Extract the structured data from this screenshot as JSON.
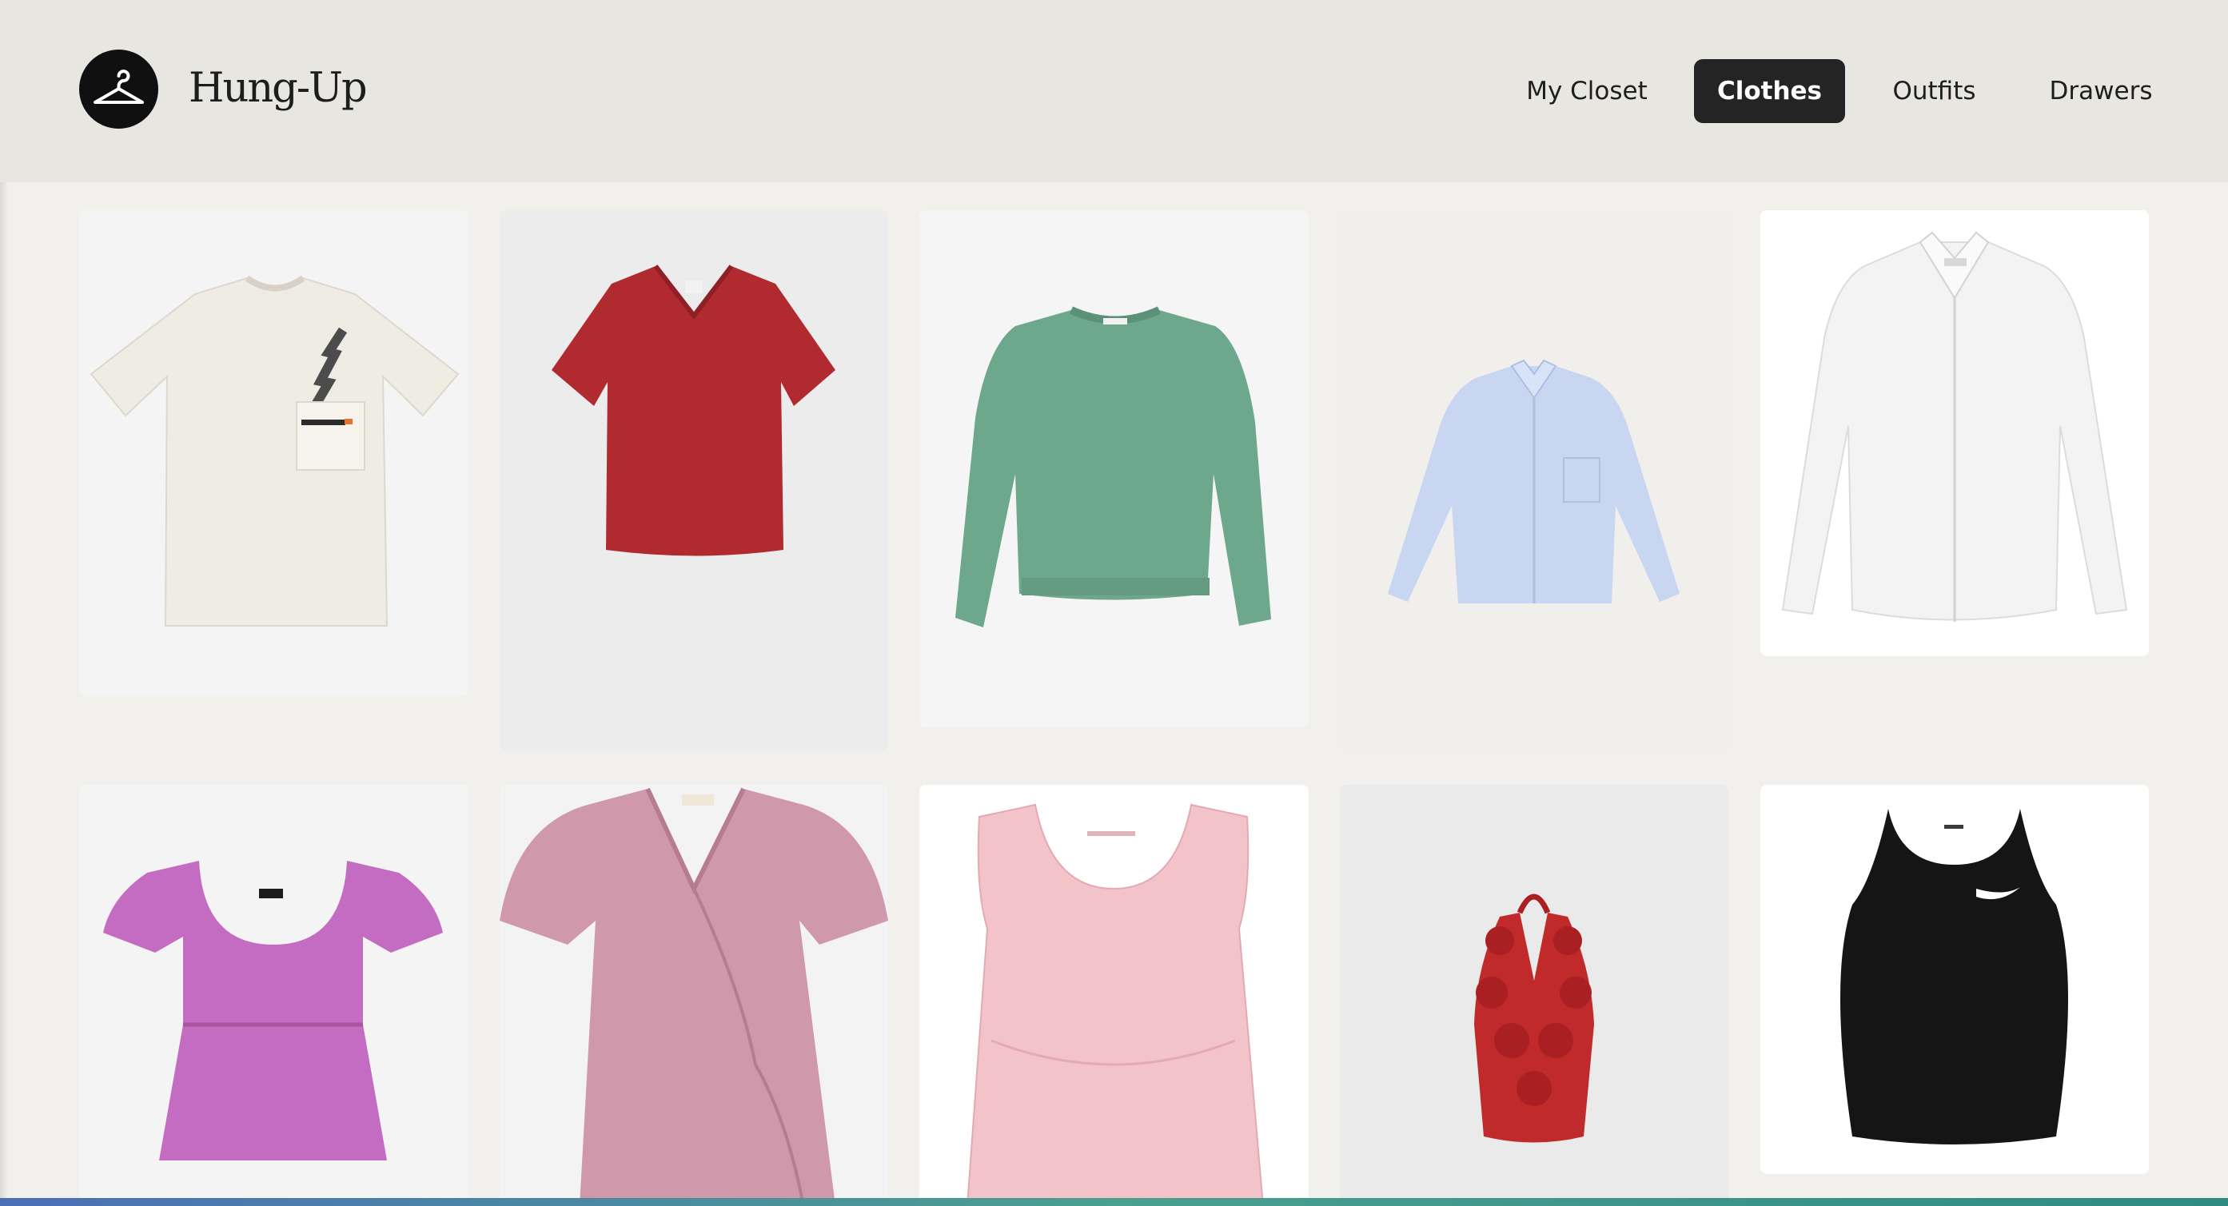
{
  "header": {
    "logo_icon": "hanger-icon",
    "brand_name": "Hung-Up"
  },
  "nav": {
    "active": "Clothes",
    "items": [
      {
        "label": "My Closet"
      },
      {
        "label": "Clothes"
      },
      {
        "label": "Outfits"
      },
      {
        "label": "Drawers"
      }
    ]
  },
  "grid": {
    "items": [
      {
        "name": "white-graphic-tshirt",
        "color": "#efece4"
      },
      {
        "name": "red-vneck-tshirt",
        "color": "#b02a30"
      },
      {
        "name": "green-crewneck-sweatshirt",
        "color": "#6ea88c"
      },
      {
        "name": "light-blue-button-down-shirt",
        "color": "#c8d6f2"
      },
      {
        "name": "white-button-down-shirt",
        "color": "#f3f3f4"
      },
      {
        "name": "purple-peplum-top",
        "color": "#c46bc2"
      },
      {
        "name": "pink-wrap-dress",
        "color": "#cf98ab"
      },
      {
        "name": "pink-sleeveless-top",
        "color": "#f2c3c8"
      },
      {
        "name": "red-rosette-halter-top",
        "color": "#c12a2a"
      },
      {
        "name": "black-racerback-tank",
        "color": "#151515"
      }
    ]
  }
}
